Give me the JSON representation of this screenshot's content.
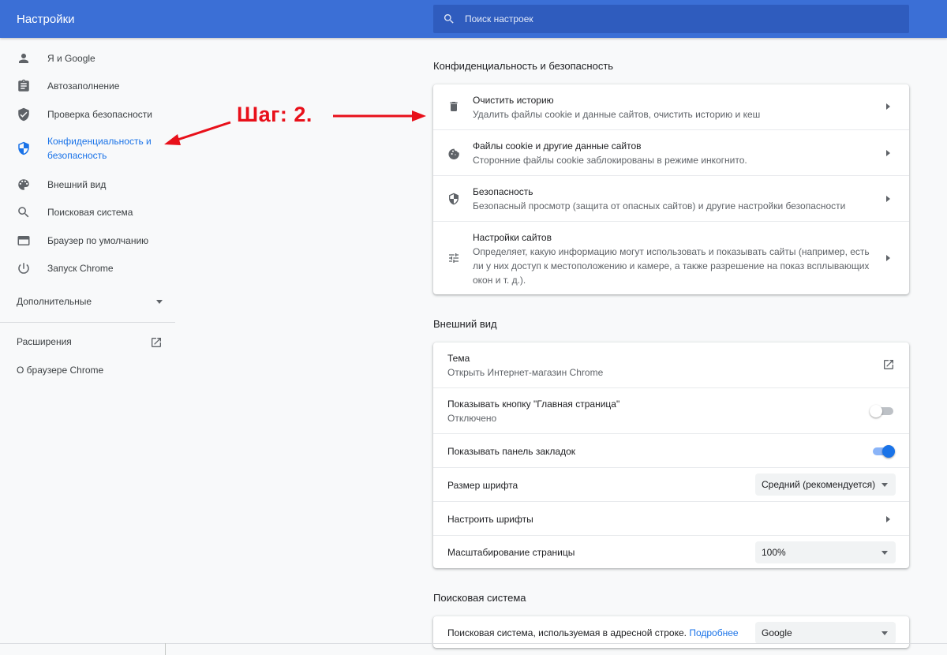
{
  "header": {
    "title": "Настройки",
    "search_placeholder": "Поиск настроек"
  },
  "sidebar": {
    "items": [
      {
        "label": "Я и Google",
        "icon": "person-icon"
      },
      {
        "label": "Автозаполнение",
        "icon": "clipboard-icon"
      },
      {
        "label": "Проверка безопасности",
        "icon": "shield-check-icon"
      },
      {
        "label": "Конфиденциальность и безопасность",
        "icon": "privacy-shield-icon",
        "active": true
      },
      {
        "label": "Внешний вид",
        "icon": "palette-icon"
      },
      {
        "label": "Поисковая система",
        "icon": "search-icon"
      },
      {
        "label": "Браузер по умолчанию",
        "icon": "browser-icon"
      },
      {
        "label": "Запуск Chrome",
        "icon": "power-icon"
      }
    ],
    "advanced": "Дополнительные",
    "extensions": "Расширения",
    "about": "О браузере Chrome"
  },
  "annotation": {
    "text": "Шаг: 2.",
    "color": "#e8101a"
  },
  "privacy": {
    "title": "Конфиденциальность и безопасность",
    "rows": [
      {
        "title": "Очистить историю",
        "subtitle": "Удалить файлы cookie и данные сайтов, очистить историю и кеш",
        "icon": "trash-icon"
      },
      {
        "title": "Файлы cookie и другие данные сайтов",
        "subtitle": "Сторонние файлы cookie заблокированы в режиме инкогнито.",
        "icon": "cookie-icon"
      },
      {
        "title": "Безопасность",
        "subtitle": "Безопасный просмотр (защита от опасных сайтов) и другие настройки безопасности",
        "icon": "security-shield-icon"
      },
      {
        "title": "Настройки сайтов",
        "subtitle_lines": [
          "Определяет, какую информацию могут использовать и показывать сайты (например, есть",
          "ли у них доступ к местоположению и камере, а также разрешение на показ всплывающих",
          "окон и т. д.)."
        ],
        "icon": "tune-icon"
      }
    ]
  },
  "appearance": {
    "title": "Внешний вид",
    "theme_title": "Тема",
    "theme_subtitle": "Открыть Интернет-магазин Chrome",
    "home_button_title": "Показывать кнопку \"Главная страница\"",
    "home_button_subtitle": "Отключено",
    "home_button_enabled": false,
    "bookmarks_bar_title": "Показывать панель закладок",
    "bookmarks_bar_enabled": true,
    "font_size_label": "Размер шрифта",
    "font_size_value": "Средний (рекомендуется)",
    "customize_fonts": "Настроить шрифты",
    "page_zoom_label": "Масштабирование страницы",
    "page_zoom_value": "100%"
  },
  "search_engine": {
    "title": "Поисковая система",
    "row_label": "Поисковая система, используемая в адресной строке.",
    "learn_more": "Подробнее",
    "value": "Google"
  },
  "colors": {
    "header": "#3b6fd6",
    "accent": "#1a73e8",
    "annotation": "#e8101a"
  }
}
